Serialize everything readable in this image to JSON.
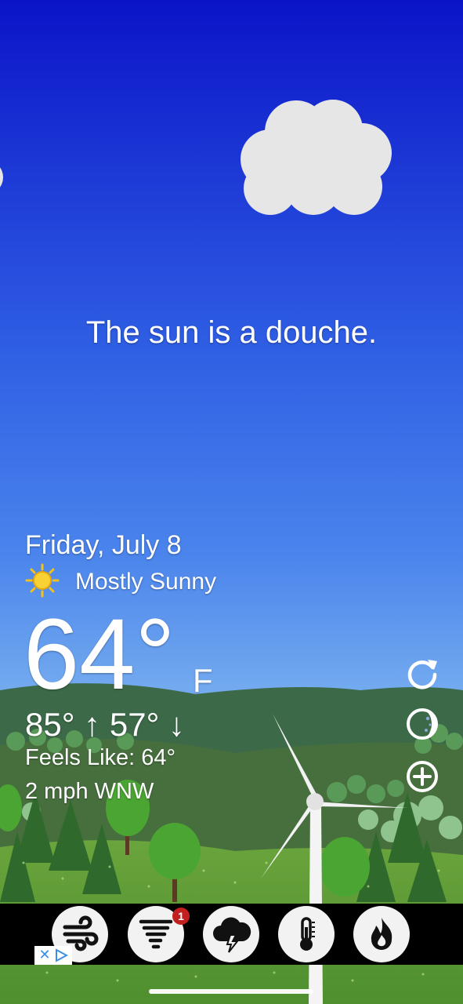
{
  "tagline": "The sun is a douche.",
  "forecast": {
    "date": "Friday, July 8",
    "condition": "Mostly Sunny",
    "condition_icon": "sun-icon",
    "temperature": "64°",
    "unit": "F",
    "high": "85°",
    "low": "57°",
    "feels_like": "Feels Like: 64°",
    "wind": "2 mph WNW"
  },
  "side_actions": [
    "refresh-icon",
    "moon-phase-icon",
    "add-location-icon"
  ],
  "toolbar": {
    "items": [
      {
        "icon": "wind-icon"
      },
      {
        "icon": "tornado-icon",
        "badge": "1"
      },
      {
        "icon": "storm-cloud-icon"
      },
      {
        "icon": "thermometer-icon"
      },
      {
        "icon": "fire-icon"
      }
    ]
  },
  "colors": {
    "sky_top": "#0b14c8",
    "sky_mid": "#3e78ea",
    "sky_bottom": "#7db3f0",
    "hill_dark": "#3c6a48",
    "grass": "#5f9e3a",
    "tree_green": "#4aa532",
    "badge_red": "#c21f1f",
    "toolbar_bg": "#000000"
  }
}
